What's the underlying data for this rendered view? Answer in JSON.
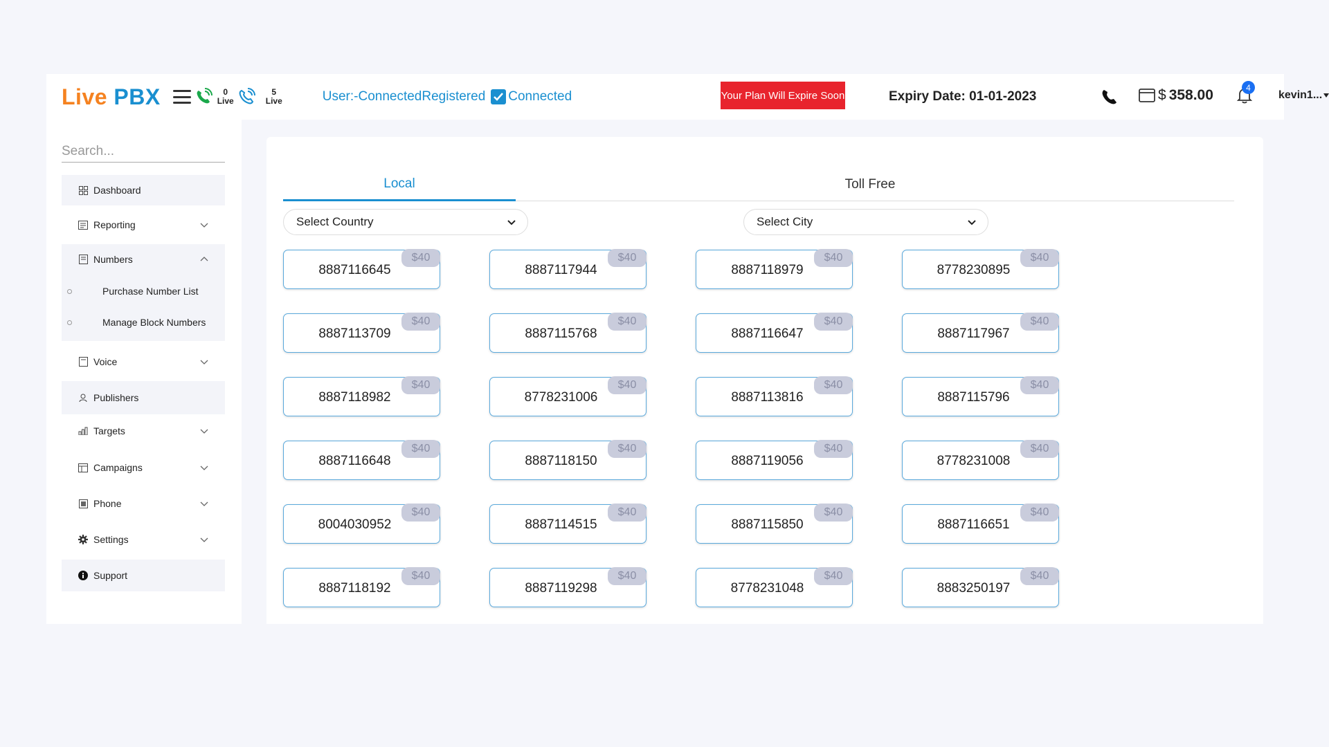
{
  "header": {
    "logo_part1": "Live",
    "logo_part2": "PBX",
    "live_count_1": "0",
    "live_label_1": "Live",
    "live_count_2": "5",
    "live_label_2": "Live",
    "user_status_prefix": "User:-ConnectedRegistered",
    "connected_label": "Connected",
    "expire_button": "Your Plan Will Expire Soon",
    "expiry_date": "Expiry Date: 01-01-2023",
    "currency": "$",
    "balance": "358.00",
    "notification_count": "4",
    "user_name": "kevin1..."
  },
  "sidebar": {
    "search_placeholder": "Search...",
    "items": [
      {
        "label": "Dashboard",
        "icon": "grid-icon"
      },
      {
        "label": "Reporting",
        "icon": "report-icon"
      },
      {
        "label": "Numbers",
        "icon": "numbers-icon"
      },
      {
        "label": "Voice",
        "icon": "voice-icon"
      },
      {
        "label": "Publishers",
        "icon": "user-icon"
      },
      {
        "label": "Targets",
        "icon": "bar-chart-icon"
      },
      {
        "label": "Campaigns",
        "icon": "table-icon"
      },
      {
        "label": "Phone",
        "icon": "phone-icon"
      },
      {
        "label": "Settings",
        "icon": "gear-icon"
      },
      {
        "label": "Support",
        "icon": "info-icon"
      }
    ],
    "numbers_sub": [
      {
        "label": "Purchase Number List"
      },
      {
        "label": "Manage Block Numbers"
      }
    ]
  },
  "main": {
    "tabs": [
      {
        "label": "Local",
        "active": true
      },
      {
        "label": "Toll Free",
        "active": false
      }
    ],
    "country_select": "Select Country",
    "city_select": "Select City",
    "numbers": [
      {
        "number": "8887116645",
        "price": "$40"
      },
      {
        "number": "8887117944",
        "price": "$40"
      },
      {
        "number": "8887118979",
        "price": "$40"
      },
      {
        "number": "8778230895",
        "price": "$40"
      },
      {
        "number": "8887113709",
        "price": "$40"
      },
      {
        "number": "8887115768",
        "price": "$40"
      },
      {
        "number": "8887116647",
        "price": "$40"
      },
      {
        "number": "8887117967",
        "price": "$40"
      },
      {
        "number": "8887118982",
        "price": "$40"
      },
      {
        "number": "8778231006",
        "price": "$40"
      },
      {
        "number": "8887113816",
        "price": "$40"
      },
      {
        "number": "8887115796",
        "price": "$40"
      },
      {
        "number": "8887116648",
        "price": "$40"
      },
      {
        "number": "8887118150",
        "price": "$40"
      },
      {
        "number": "8887119056",
        "price": "$40"
      },
      {
        "number": "8778231008",
        "price": "$40"
      },
      {
        "number": "8004030952",
        "price": "$40"
      },
      {
        "number": "8887114515",
        "price": "$40"
      },
      {
        "number": "8887115850",
        "price": "$40"
      },
      {
        "number": "8887116651",
        "price": "$40"
      },
      {
        "number": "8887118192",
        "price": "$40"
      },
      {
        "number": "8887119298",
        "price": "$40"
      },
      {
        "number": "8778231048",
        "price": "$40"
      },
      {
        "number": "8883250197",
        "price": "$40"
      }
    ]
  },
  "colors": {
    "brand_orange": "#f58220",
    "brand_blue": "#1a8fd0",
    "alert_red": "#e8242d",
    "price_badge": "#c9ccdc"
  }
}
